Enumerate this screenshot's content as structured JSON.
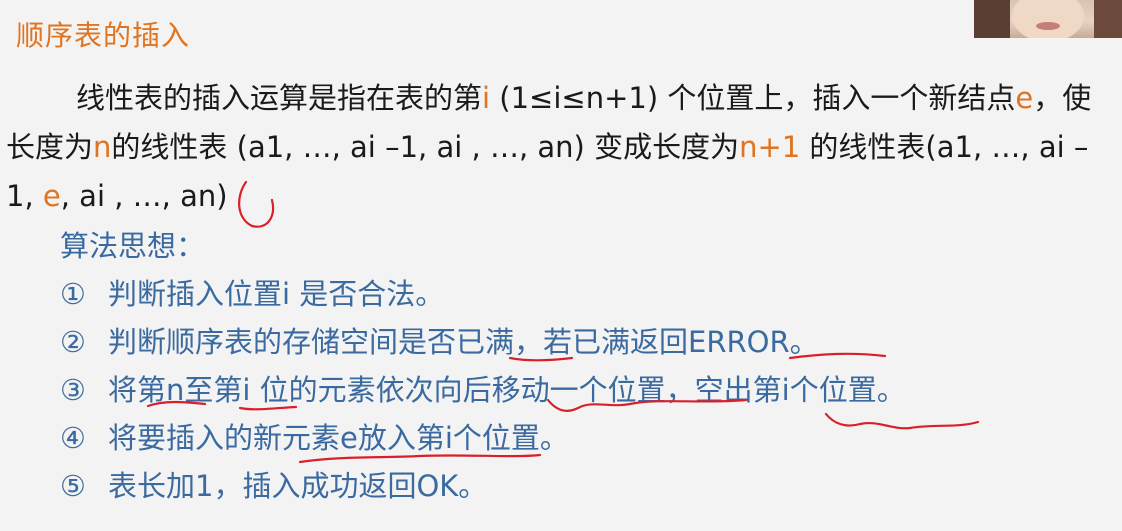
{
  "title": "顺序表的插入",
  "paragraph": {
    "p1": "线性表的插入运算是指在表的第",
    "i": "i",
    "p2": " (1≤i≤n+1) 个位置上，插入一个新结点",
    "e": "e",
    "p3": "，使长度为",
    "n": "n",
    "p4": "的线性表 (a1, …, ai –1, ai , …, an) 变成长度为",
    "n1": "n+1",
    "p5": " 的线性表(a1, …, ai –1, ",
    "e2": "e",
    "p6": ", ai , …, an)"
  },
  "algorithm": {
    "heading": "算法思想：",
    "steps": [
      {
        "num": "①",
        "text": "判断插入位置i 是否合法。"
      },
      {
        "num": "②",
        "text": "判断顺序表的存储空间是否已满，若已满返回ERROR。"
      },
      {
        "num": "③",
        "text": "将第n至第i 位的元素依次向后移动一个位置，空出第i个位置。"
      },
      {
        "num": "④",
        "text": "将要插入的新元素e放入第i个位置。"
      },
      {
        "num": "⑤",
        "text": "表长加1，插入成功返回OK。"
      }
    ]
  },
  "colors": {
    "orange": "#e07420",
    "blue": "#3b6aa0",
    "ink": "#d9202a"
  }
}
